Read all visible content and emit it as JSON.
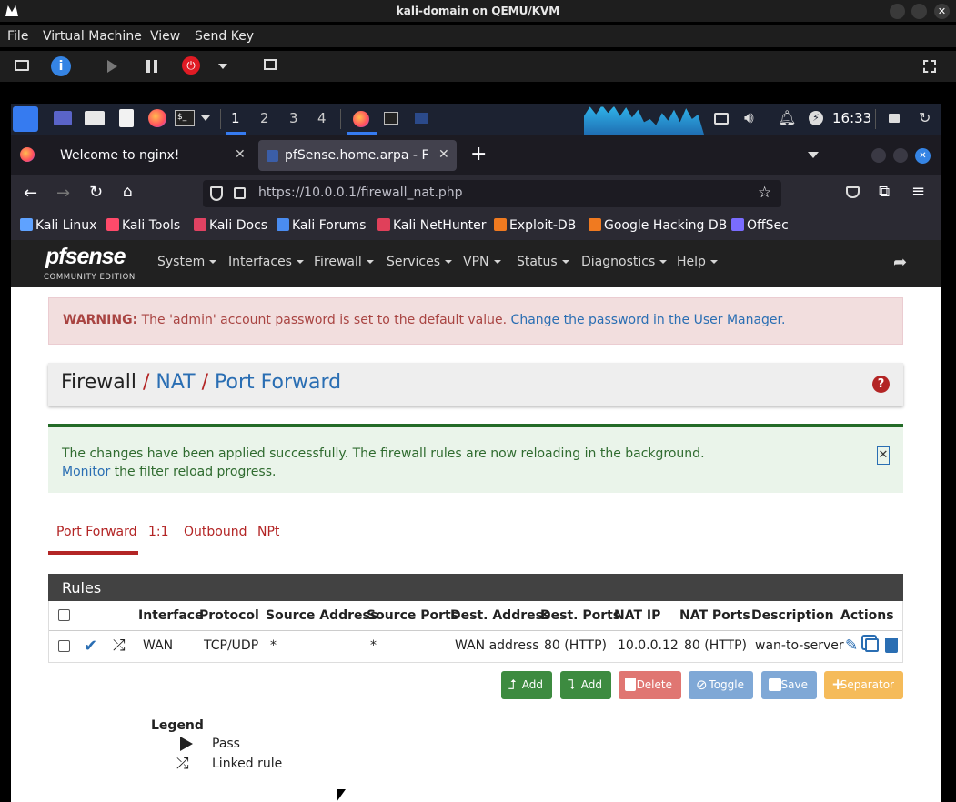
{
  "vm": {
    "title": "kali-domain on QEMU/KVM",
    "menu": [
      "File",
      "Virtual Machine",
      "View",
      "Send Key"
    ]
  },
  "panel": {
    "workspaces": [
      "1",
      "2",
      "3",
      "4"
    ],
    "clock": "16:33"
  },
  "browser": {
    "tabs": [
      {
        "label": "Welcome to nginx!",
        "active": false
      },
      {
        "label": "pfSense.home.arpa - Fire",
        "active": true
      }
    ],
    "url": "https://10.0.0.1/firewall_nat.php",
    "url_host": "10.0.0.1",
    "bookmarks": [
      "Kali Linux",
      "Kali Tools",
      "Kali Docs",
      "Kali Forums",
      "Kali NetHunter",
      "Exploit-DB",
      "Google Hacking DB",
      "OffSec"
    ]
  },
  "pfsense": {
    "logo": "pfsense",
    "logo_sub": "COMMUNITY EDITION",
    "nav": [
      "System",
      "Interfaces",
      "Firewall",
      "Services",
      "VPN",
      "Status",
      "Diagnostics",
      "Help"
    ],
    "warning_label": "WARNING:",
    "warning_text": "The 'admin' account password is set to the default value.",
    "warning_link": "Change the password in the User Manager.",
    "breadcrumb": [
      "Firewall",
      "NAT",
      "Port Forward"
    ],
    "success_line1": "The changes have been applied successfully. The firewall rules are now reloading in the background.",
    "success_link": "Monitor",
    "success_line2": "the filter reload progress.",
    "tabs": [
      "Port Forward",
      "1:1",
      "Outbound",
      "NPt"
    ],
    "rules_title": "Rules",
    "columns": [
      "Interface",
      "Protocol",
      "Source Address",
      "Source Ports",
      "Dest. Address",
      "Dest. Ports",
      "NAT IP",
      "NAT Ports",
      "Description",
      "Actions"
    ],
    "rows": [
      {
        "interface": "WAN",
        "protocol": "TCP/UDP",
        "src_addr": "*",
        "src_ports": "*",
        "dest_addr": "WAN address",
        "dest_ports": "80 (HTTP)",
        "nat_ip": "10.0.0.12",
        "nat_ports": "80 (HTTP)",
        "description": "wan-to-server"
      }
    ],
    "buttons": [
      "Add",
      "Add",
      "Delete",
      "Toggle",
      "Save",
      "Separator"
    ],
    "legend_title": "Legend",
    "legend": [
      "Pass",
      "Linked rule"
    ]
  }
}
